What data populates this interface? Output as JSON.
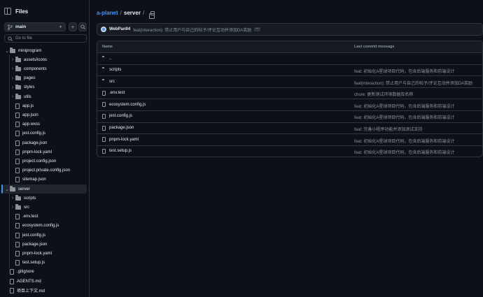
{
  "sidebar": {
    "title": "Files",
    "branch": "main",
    "goto_placeholder": "Go to file",
    "tree": [
      {
        "label": "miniprogram",
        "type": "folder",
        "depth": 0,
        "expanded": true
      },
      {
        "label": "assets/icons",
        "type": "folder",
        "depth": 1,
        "expanded": false
      },
      {
        "label": "components",
        "type": "folder",
        "depth": 1,
        "expanded": false
      },
      {
        "label": "pages",
        "type": "folder",
        "depth": 1,
        "expanded": false
      },
      {
        "label": "styles",
        "type": "folder",
        "depth": 1,
        "expanded": false
      },
      {
        "label": "utils",
        "type": "folder",
        "depth": 1,
        "expanded": false
      },
      {
        "label": "app.js",
        "type": "file",
        "depth": 1
      },
      {
        "label": "app.json",
        "type": "file",
        "depth": 1
      },
      {
        "label": "app.wxss",
        "type": "file",
        "depth": 1
      },
      {
        "label": "jest.config.js",
        "type": "file",
        "depth": 1
      },
      {
        "label": "package.json",
        "type": "file",
        "depth": 1
      },
      {
        "label": "pnpm-lock.yaml",
        "type": "file",
        "depth": 1
      },
      {
        "label": "project.config.json",
        "type": "file",
        "depth": 1
      },
      {
        "label": "project.private.config.json",
        "type": "file",
        "depth": 1
      },
      {
        "label": "sitemap.json",
        "type": "file",
        "depth": 1
      },
      {
        "label": "server",
        "type": "folder",
        "depth": 0,
        "expanded": true,
        "selected": true
      },
      {
        "label": "scripts",
        "type": "folder",
        "depth": 1,
        "expanded": false
      },
      {
        "label": "src",
        "type": "folder",
        "depth": 1,
        "expanded": false
      },
      {
        "label": ".env.test",
        "type": "file",
        "depth": 1
      },
      {
        "label": "ecosystem.config.js",
        "type": "file",
        "depth": 1
      },
      {
        "label": "jest.config.js",
        "type": "file",
        "depth": 1
      },
      {
        "label": "package.json",
        "type": "file",
        "depth": 1
      },
      {
        "label": "pnpm-lock.yaml",
        "type": "file",
        "depth": 1
      },
      {
        "label": "test.setup.js",
        "type": "file",
        "depth": 1
      },
      {
        "label": ".gitignore",
        "type": "file",
        "depth": 0
      },
      {
        "label": "AGENTS.md",
        "type": "file",
        "depth": 0
      },
      {
        "label": "项目上下文.md",
        "type": "file",
        "depth": 0
      }
    ]
  },
  "breadcrumb": {
    "repo": "a-planet",
    "folder": "server",
    "sep1": "/",
    "sep2": "/"
  },
  "latest_commit": {
    "author": "WebPan94",
    "message": "feat(interaction): 禁止用户与自己的帖子/评论互动并添加DA奖励"
  },
  "table": {
    "col_name": "Name",
    "col_message": "Last commit message",
    "rows": [
      {
        "name": "..",
        "type": "parent",
        "message": ""
      },
      {
        "name": "scripts",
        "type": "folder",
        "message": "feat: 初始化A星球项目代码，包含后端服务和前端设计"
      },
      {
        "name": "src",
        "type": "folder",
        "message": "feat(interaction): 禁止用户与自己的帖子/评论互动并添加DA奖励"
      },
      {
        "name": ".env.test",
        "type": "file",
        "message": "chore: 更新测试环境数据库名称"
      },
      {
        "name": "ecosystem.config.js",
        "type": "file",
        "message": "feat: 初始化A星球项目代码，包含后端服务和前端设计"
      },
      {
        "name": "jest.config.js",
        "type": "file",
        "message": "feat: 初始化A星球项目代码，包含后端服务和前端设计"
      },
      {
        "name": "package.json",
        "type": "file",
        "message": "feat: 完善小程序功能并添加测试支持"
      },
      {
        "name": "pnpm-lock.yaml",
        "type": "file",
        "message": "feat: 初始化A星球项目代码，包含后端服务和前端设计"
      },
      {
        "name": "test.setup.js",
        "type": "file",
        "message": "feat: 初始化A星球项目代码，包含后端服务和前端设计"
      }
    ]
  },
  "colors": {
    "background": "#0d1117",
    "panel": "#161b22",
    "border": "#30363d",
    "accent": "#4493f8",
    "text": "#e6edf3",
    "muted": "#8b949e"
  }
}
